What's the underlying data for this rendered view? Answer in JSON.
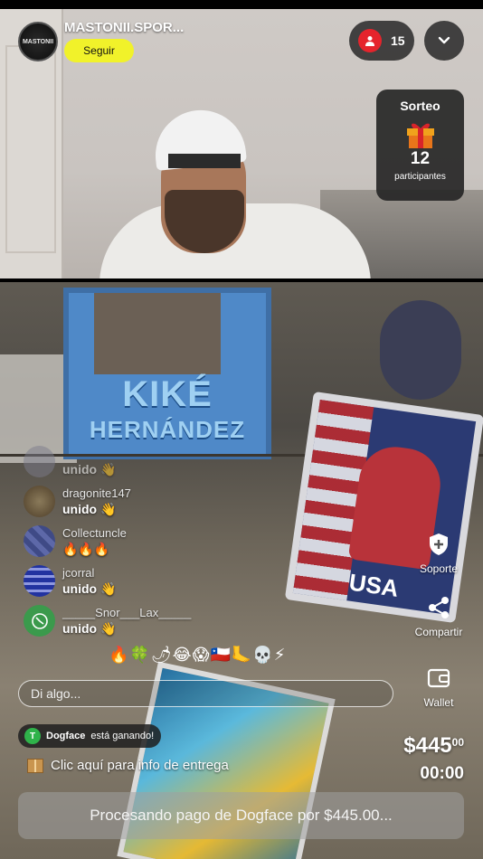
{
  "header": {
    "streamer_name": "MASTONII.SPOR...",
    "avatar_text": "MASTONII",
    "follow_label": "Seguir",
    "viewer_count": "15"
  },
  "sorteo": {
    "title": "Sorteo",
    "count": "12",
    "subtitle": "participantes"
  },
  "background": {
    "sign_line1": "KIKÉ",
    "sign_line2": "HERNÁNDEZ",
    "card_text": "USA"
  },
  "chat": [
    {
      "user": "",
      "text": "unido 👋",
      "avatar_color": "#7b7b8b"
    },
    {
      "user": "dragonite147",
      "text": "unido 👋",
      "avatar_color": "#6d5a3e"
    },
    {
      "user": "Collectuncle",
      "text": "🔥🔥🔥",
      "avatar_color": "#3f4a86"
    },
    {
      "user": "jcorral",
      "text": "unido 👋",
      "avatar_color": "#2233a0"
    },
    {
      "user": "_____Snor___Lax_____",
      "text": "unido 👋",
      "avatar_color": "#3b9a4c"
    }
  ],
  "emoji_row": "🔥🍀🌶😂😱🇨🇱🦶💀⚡",
  "chat_input": {
    "placeholder": "Di algo..."
  },
  "winner": {
    "name": "Dogface",
    "status": "está ganando!"
  },
  "delivery": {
    "label": "Clic aquí para info de entrega"
  },
  "price": {
    "main": "$445",
    "cents": "00"
  },
  "timer": "00:00",
  "processing": "Procesando pago de Dogface por $445.00...",
  "actions": {
    "soporte": "Soporte",
    "compartir": "Compartir",
    "wallet": "Wallet"
  },
  "colors": {
    "follow": "#f1f22a",
    "viewer_dot": "#e5242c",
    "winner_tick": "#2fb34a"
  }
}
